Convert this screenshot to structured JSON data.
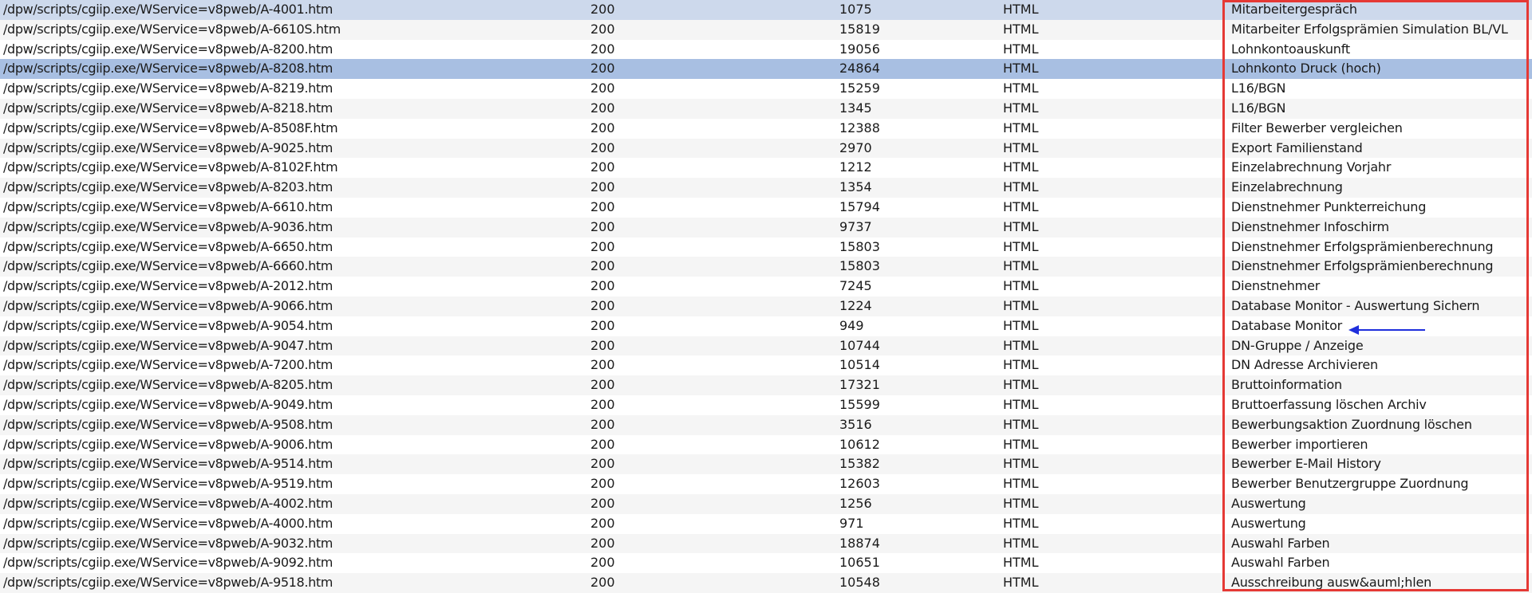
{
  "annotation": {
    "box_color": "#e53935",
    "arrow_color": "#1f2fdc",
    "arrow_target": "Database Monitor"
  },
  "rows": [
    {
      "url": "/dpw/scripts/cgiip.exe/WService=v8pweb/A-4001.htm",
      "status": "200",
      "size": "1075",
      "type": "HTML",
      "title": "Mitarbeitergespräch",
      "state": "selected-light"
    },
    {
      "url": "/dpw/scripts/cgiip.exe/WService=v8pweb/A-6610S.htm",
      "status": "200",
      "size": "15819",
      "type": "HTML",
      "title": "Mitarbeiter Erfolgsprämien Simulation BL/VL",
      "state": "normal"
    },
    {
      "url": "/dpw/scripts/cgiip.exe/WService=v8pweb/A-8200.htm",
      "status": "200",
      "size": "19056",
      "type": "HTML",
      "title": "Lohnkontoauskunft",
      "state": "normal"
    },
    {
      "url": "/dpw/scripts/cgiip.exe/WService=v8pweb/A-8208.htm",
      "status": "200",
      "size": "24864",
      "type": "HTML",
      "title": "Lohnkonto Druck (hoch)",
      "state": "selected"
    },
    {
      "url": "/dpw/scripts/cgiip.exe/WService=v8pweb/A-8219.htm",
      "status": "200",
      "size": "15259",
      "type": "HTML",
      "title": "L16/BGN",
      "state": "normal"
    },
    {
      "url": "/dpw/scripts/cgiip.exe/WService=v8pweb/A-8218.htm",
      "status": "200",
      "size": "1345",
      "type": "HTML",
      "title": "L16/BGN",
      "state": "normal"
    },
    {
      "url": "/dpw/scripts/cgiip.exe/WService=v8pweb/A-8508F.htm",
      "status": "200",
      "size": "12388",
      "type": "HTML",
      "title": "Filter Bewerber vergleichen",
      "state": "normal"
    },
    {
      "url": "/dpw/scripts/cgiip.exe/WService=v8pweb/A-9025.htm",
      "status": "200",
      "size": "2970",
      "type": "HTML",
      "title": "Export Familienstand",
      "state": "normal"
    },
    {
      "url": "/dpw/scripts/cgiip.exe/WService=v8pweb/A-8102F.htm",
      "status": "200",
      "size": "1212",
      "type": "HTML",
      "title": "Einzelabrechnung Vorjahr",
      "state": "normal"
    },
    {
      "url": "/dpw/scripts/cgiip.exe/WService=v8pweb/A-8203.htm",
      "status": "200",
      "size": "1354",
      "type": "HTML",
      "title": "Einzelabrechnung",
      "state": "normal"
    },
    {
      "url": "/dpw/scripts/cgiip.exe/WService=v8pweb/A-6610.htm",
      "status": "200",
      "size": "15794",
      "type": "HTML",
      "title": "Dienstnehmer Punkterreichung",
      "state": "normal"
    },
    {
      "url": "/dpw/scripts/cgiip.exe/WService=v8pweb/A-9036.htm",
      "status": "200",
      "size": "9737",
      "type": "HTML",
      "title": "Dienstnehmer Infoschirm",
      "state": "normal"
    },
    {
      "url": "/dpw/scripts/cgiip.exe/WService=v8pweb/A-6650.htm",
      "status": "200",
      "size": "15803",
      "type": "HTML",
      "title": "Dienstnehmer Erfolgsprämienberechnung",
      "state": "normal"
    },
    {
      "url": "/dpw/scripts/cgiip.exe/WService=v8pweb/A-6660.htm",
      "status": "200",
      "size": "15803",
      "type": "HTML",
      "title": "Dienstnehmer Erfolgsprämienberechnung",
      "state": "normal"
    },
    {
      "url": "/dpw/scripts/cgiip.exe/WService=v8pweb/A-2012.htm",
      "status": "200",
      "size": "7245",
      "type": "HTML",
      "title": "Dienstnehmer",
      "state": "normal"
    },
    {
      "url": "/dpw/scripts/cgiip.exe/WService=v8pweb/A-9066.htm",
      "status": "200",
      "size": "1224",
      "type": "HTML",
      "title": "Database Monitor - Auswertung Sichern",
      "state": "normal"
    },
    {
      "url": "/dpw/scripts/cgiip.exe/WService=v8pweb/A-9054.htm",
      "status": "200",
      "size": "949",
      "type": "HTML",
      "title": "Database Monitor",
      "state": "normal"
    },
    {
      "url": "/dpw/scripts/cgiip.exe/WService=v8pweb/A-9047.htm",
      "status": "200",
      "size": "10744",
      "type": "HTML",
      "title": "DN-Gruppe / Anzeige",
      "state": "normal"
    },
    {
      "url": "/dpw/scripts/cgiip.exe/WService=v8pweb/A-7200.htm",
      "status": "200",
      "size": "10514",
      "type": "HTML",
      "title": "DN Adresse Archivieren",
      "state": "normal"
    },
    {
      "url": "/dpw/scripts/cgiip.exe/WService=v8pweb/A-8205.htm",
      "status": "200",
      "size": "17321",
      "type": "HTML",
      "title": "Bruttoinformation",
      "state": "normal"
    },
    {
      "url": "/dpw/scripts/cgiip.exe/WService=v8pweb/A-9049.htm",
      "status": "200",
      "size": "15599",
      "type": "HTML",
      "title": "Bruttoerfassung löschen Archiv",
      "state": "normal"
    },
    {
      "url": "/dpw/scripts/cgiip.exe/WService=v8pweb/A-9508.htm",
      "status": "200",
      "size": "3516",
      "type": "HTML",
      "title": "Bewerbungsaktion Zuordnung löschen",
      "state": "normal"
    },
    {
      "url": "/dpw/scripts/cgiip.exe/WService=v8pweb/A-9006.htm",
      "status": "200",
      "size": "10612",
      "type": "HTML",
      "title": "Bewerber importieren",
      "state": "normal"
    },
    {
      "url": "/dpw/scripts/cgiip.exe/WService=v8pweb/A-9514.htm",
      "status": "200",
      "size": "15382",
      "type": "HTML",
      "title": "Bewerber E-Mail History",
      "state": "normal"
    },
    {
      "url": "/dpw/scripts/cgiip.exe/WService=v8pweb/A-9519.htm",
      "status": "200",
      "size": "12603",
      "type": "HTML",
      "title": "Bewerber Benutzergruppe Zuordnung",
      "state": "normal"
    },
    {
      "url": "/dpw/scripts/cgiip.exe/WService=v8pweb/A-4002.htm",
      "status": "200",
      "size": "1256",
      "type": "HTML",
      "title": "Auswertung",
      "state": "normal"
    },
    {
      "url": "/dpw/scripts/cgiip.exe/WService=v8pweb/A-4000.htm",
      "status": "200",
      "size": "971",
      "type": "HTML",
      "title": "Auswertung",
      "state": "normal"
    },
    {
      "url": "/dpw/scripts/cgiip.exe/WService=v8pweb/A-9032.htm",
      "status": "200",
      "size": "18874",
      "type": "HTML",
      "title": "Auswahl Farben",
      "state": "normal"
    },
    {
      "url": "/dpw/scripts/cgiip.exe/WService=v8pweb/A-9092.htm",
      "status": "200",
      "size": "10651",
      "type": "HTML",
      "title": "Auswahl Farben",
      "state": "normal"
    },
    {
      "url": "/dpw/scripts/cgiip.exe/WService=v8pweb/A-9518.htm",
      "status": "200",
      "size": "10548",
      "type": "HTML",
      "title": "Ausschreibung ausw&auml;hlen",
      "state": "normal"
    }
  ]
}
